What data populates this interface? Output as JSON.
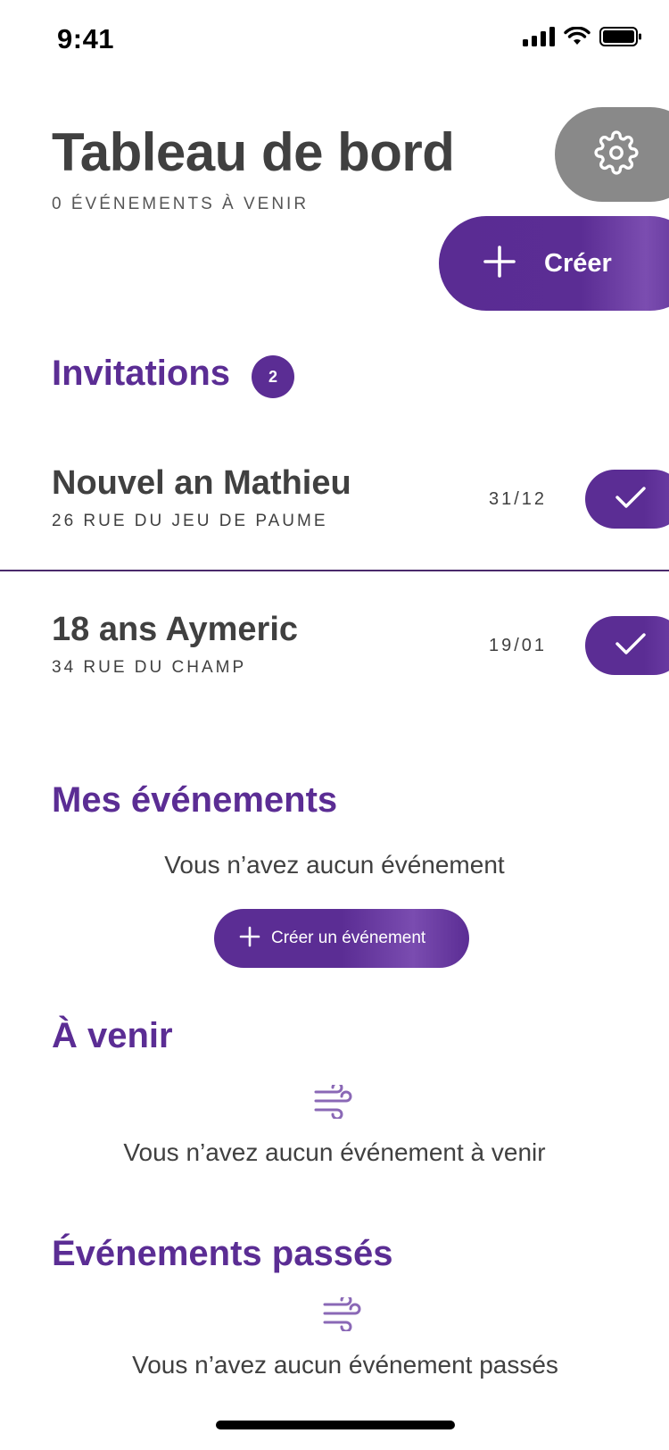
{
  "status_bar": {
    "time": "9:41"
  },
  "header": {
    "title": "Tableau de bord",
    "subtitle": "0 ÉVÉNEMENTS À VENIR",
    "create_label": "Créer"
  },
  "invitations": {
    "title": "Invitations",
    "count": "2",
    "items": [
      {
        "name": "Nouvel an Mathieu",
        "address": "26 RUE DU JEU DE PAUME",
        "date": "31/12"
      },
      {
        "name": "18 ans Aymeric",
        "address": "34 RUE DU CHAMP",
        "date": "19/01"
      }
    ]
  },
  "my_events": {
    "title": "Mes événements",
    "empty_text": "Vous n’avez aucun événement",
    "create_label": "Créer un événement"
  },
  "upcoming": {
    "title": "À venir",
    "empty_text": "Vous n’avez aucun événement à venir"
  },
  "past": {
    "title": "Événements passés",
    "empty_text": "Vous n’avez aucun événement passés"
  },
  "colors": {
    "accent": "#5b2d94",
    "text": "#404040",
    "settings_bg": "#898989"
  },
  "icons": [
    "signal-icon",
    "wifi-icon",
    "battery-icon",
    "gear-icon",
    "plus-icon",
    "check-icon",
    "wind-icon"
  ]
}
